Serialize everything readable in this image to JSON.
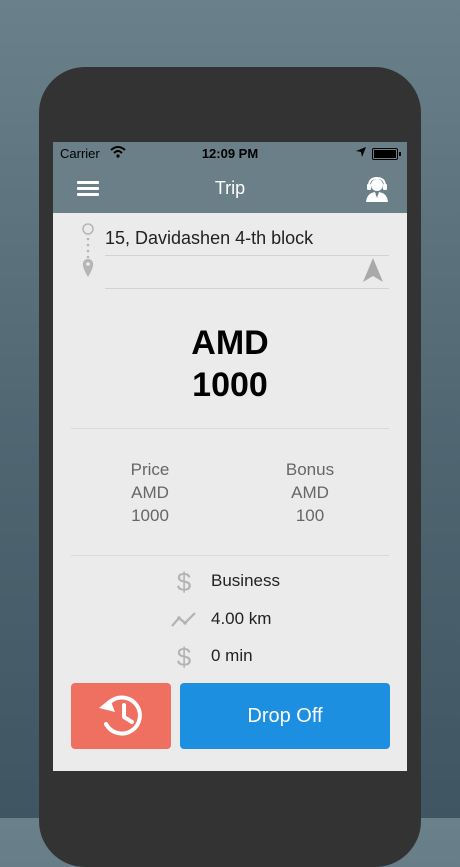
{
  "status_bar": {
    "carrier": "Carrier",
    "time": "12:09 PM",
    "battery_level": 0.9
  },
  "nav": {
    "title": "Trip"
  },
  "trip": {
    "address": "15, Davidashen 4-th block"
  },
  "fare": {
    "currency": "AMD",
    "amount": "1000"
  },
  "price": {
    "label": "Price",
    "currency": "AMD",
    "value": "1000"
  },
  "bonus": {
    "label": "Bonus",
    "currency": "AMD",
    "value": "100"
  },
  "details": {
    "class": "Business",
    "distance": "4.00 km",
    "duration": "0 min"
  },
  "buttons": {
    "drop_off": "Drop Off"
  },
  "colors": {
    "nav": "#6a7f88",
    "history": "#ef6f61",
    "drop_off": "#1d8fe1"
  }
}
